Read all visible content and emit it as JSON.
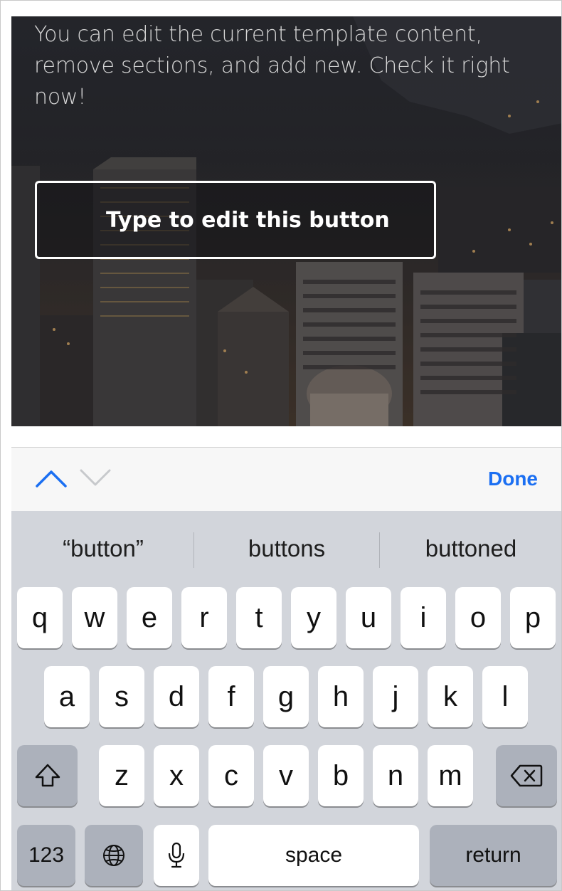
{
  "hero": {
    "paragraph": "You can edit the current template content, remove sections, and add new. Check it right now!",
    "button_label": "Type to edit this button"
  },
  "accessory": {
    "prev_icon": "chevron-up-icon",
    "next_icon": "chevron-down-icon",
    "done_label": "Done"
  },
  "suggestions": [
    "“button”",
    "buttons",
    "buttoned"
  ],
  "keyboard": {
    "row1": [
      "q",
      "w",
      "e",
      "r",
      "t",
      "y",
      "u",
      "i",
      "o",
      "p"
    ],
    "row2": [
      "a",
      "s",
      "d",
      "f",
      "g",
      "h",
      "j",
      "k",
      "l"
    ],
    "row3": [
      "z",
      "x",
      "c",
      "v",
      "b",
      "n",
      "m"
    ],
    "shift_icon": "shift-icon",
    "delete_icon": "delete-icon",
    "numbers_label": "123",
    "globe_icon": "globe-icon",
    "mic_icon": "microphone-icon",
    "space_label": "space",
    "return_label": "return"
  },
  "colors": {
    "accent": "#1b6ff2",
    "keyboard_bg": "#d2d5db",
    "key_bg": "#ffffff",
    "key_dark_bg": "#acb1bb"
  }
}
